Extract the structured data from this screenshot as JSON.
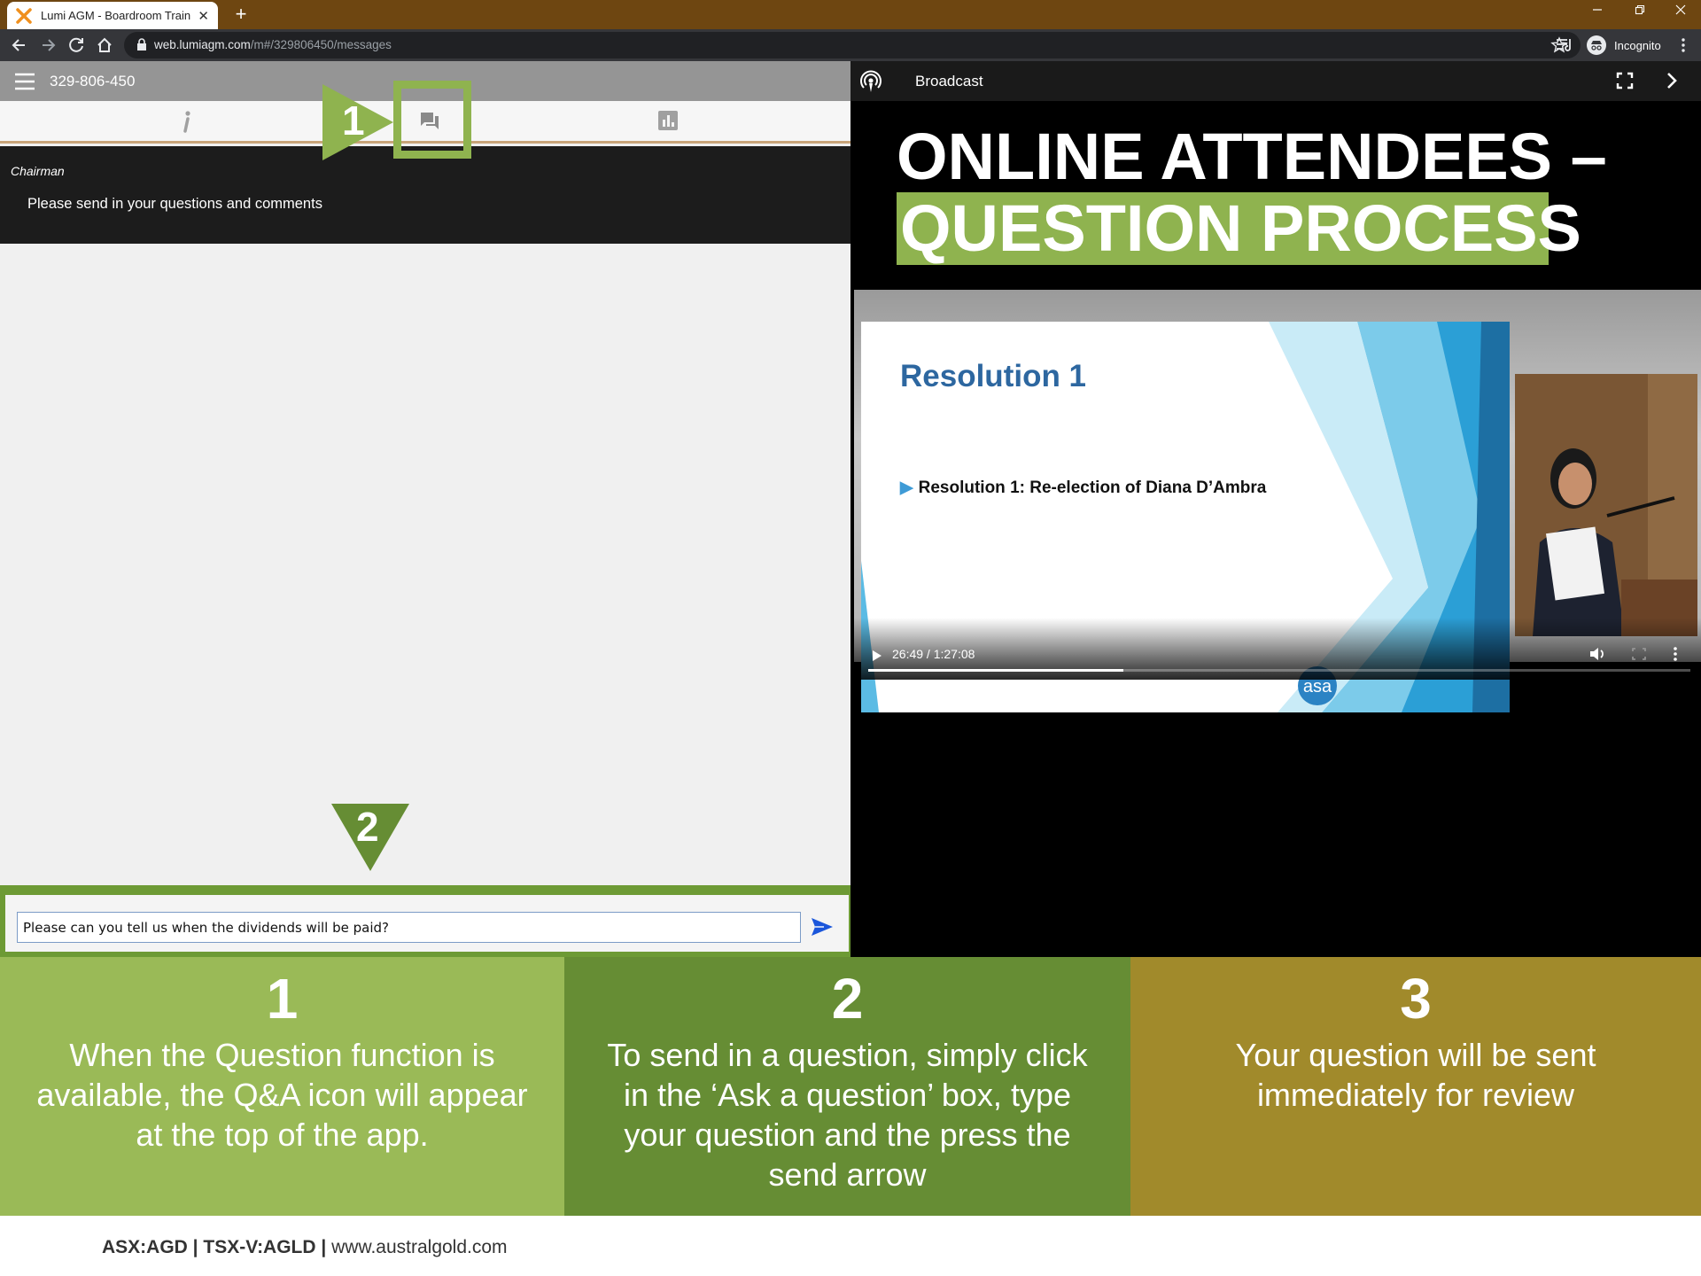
{
  "browser": {
    "tab_title": "Lumi AGM - Boardroom Training",
    "tab_close": "✕",
    "new_tab": "+",
    "url_host": "web.lumiagm.com",
    "url_path": "/m#/329806450/messages",
    "profile_label": "Incognito"
  },
  "app": {
    "meeting_id": "329-806-450",
    "message": {
      "sender": "Chairman",
      "body": "Please send in your questions and comments"
    },
    "compose": {
      "value": "Please can you tell us when the dividends will be paid?"
    }
  },
  "markers": {
    "one": "1",
    "two": "2"
  },
  "broadcast": {
    "title": "Broadcast",
    "headline_line1": "ONLINE ATTENDEES –",
    "headline_line2": "QUESTION PROCESS",
    "slide_title": "Resolution 1",
    "slide_bullet": "Resolution 1: Re-election of Diana D’Ambra",
    "slide_logo": "asa",
    "time": "26:49 / 1:27:08",
    "progress_fraction": 0.31
  },
  "steps": [
    {
      "number": "1",
      "text": "When the Question function is available, the Q&A icon will appear at the top of the app.",
      "color": "#9aba57"
    },
    {
      "number": "2",
      "text": "To send in a question, simply click in the ‘Ask a question’ box, type your question and the press the send arrow",
      "color": "#668d34"
    },
    {
      "number": "3",
      "text": "Your question will be sent immediately for review",
      "color": "#a18a2b"
    }
  ],
  "footer": {
    "tickers": "ASX:AGD | TSX-V:AGLD |",
    "website": "www.australgold.com"
  },
  "colors": {
    "accent_green": "#8fb34f",
    "browser_frame": "#6e4611",
    "send_arrow": "#1a56db"
  }
}
